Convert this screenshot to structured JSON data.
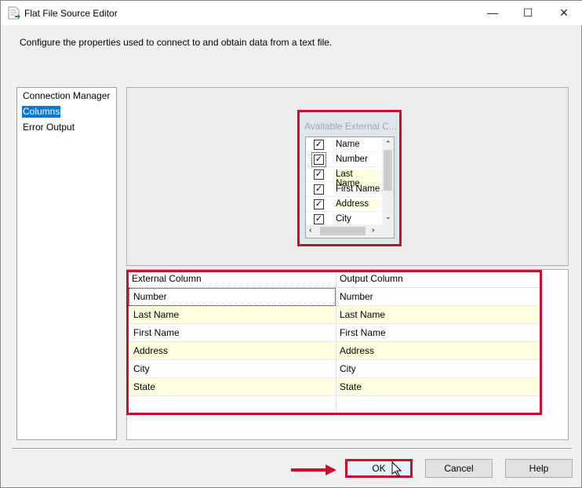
{
  "window": {
    "title": "Flat File Source Editor",
    "minimize": "—",
    "maximize": "☐",
    "close": "✕"
  },
  "description": "Configure the properties used to connect to and obtain data from a text file.",
  "nav": {
    "items": [
      {
        "label": "Connection Manager"
      },
      {
        "label": "Columns",
        "selected": true
      },
      {
        "label": "Error Output"
      }
    ]
  },
  "available": {
    "title": "Available External C...",
    "items": [
      {
        "label": "Name",
        "checked": true
      },
      {
        "label": "Number",
        "checked": true
      },
      {
        "label": "Last Name",
        "checked": true
      },
      {
        "label": "First Name",
        "checked": true
      },
      {
        "label": "Address",
        "checked": true
      },
      {
        "label": "City",
        "checked": true
      }
    ]
  },
  "grid": {
    "headers": [
      "External Column",
      "Output Column"
    ],
    "rows": [
      [
        "Number",
        "Number"
      ],
      [
        "Last Name",
        "Last Name"
      ],
      [
        "First Name",
        "First Name"
      ],
      [
        "Address",
        "Address"
      ],
      [
        "City",
        "City"
      ],
      [
        "State",
        "State"
      ]
    ]
  },
  "buttons": {
    "ok": "OK",
    "cancel": "Cancel",
    "help": "Help"
  },
  "colors": {
    "highlight": "#c8102e",
    "selection": "#0078d7"
  }
}
